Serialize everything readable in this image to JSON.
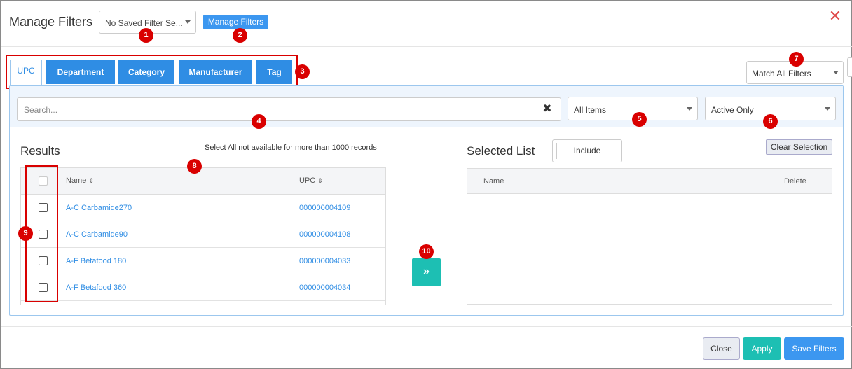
{
  "header": {
    "title": "Manage Filters",
    "saved_filter_select": "No Saved Filter Se...",
    "manage_filters_button": "Manage Filters",
    "close_glyph": "✕"
  },
  "tabs": [
    {
      "label": "UPC",
      "active": true
    },
    {
      "label": "Department",
      "active": false
    },
    {
      "label": "Category",
      "active": false
    },
    {
      "label": "Manufacturer",
      "active": false
    },
    {
      "label": "Tag",
      "active": false
    }
  ],
  "match_select": "Match All Filters",
  "filters": {
    "search_placeholder": "Search...",
    "search_clear_glyph": "✖",
    "items_select": "All Items",
    "status_select": "Active Only"
  },
  "results": {
    "title": "Results",
    "limit_note": "Select All not available for more than 1000 records",
    "columns": {
      "name": "Name",
      "upc": "UPC"
    },
    "rows": [
      {
        "name": "A-C Carbamide270",
        "upc": "000000004109"
      },
      {
        "name": "A-C Carbamide90",
        "upc": "000000004108"
      },
      {
        "name": "A-F Betafood 180",
        "upc": "000000004033"
      },
      {
        "name": "A-F Betafood 360",
        "upc": "000000004034"
      }
    ]
  },
  "selected": {
    "title": "Selected List",
    "include_label": "Include",
    "clear_selection_label": "Clear Selection",
    "columns": {
      "name": "Name",
      "delete": "Delete"
    }
  },
  "move_button_glyph": "»",
  "footer": {
    "close_label": "Close",
    "apply_label": "Apply",
    "save_label": "Save Filters"
  },
  "markers": [
    "1",
    "2",
    "3",
    "4",
    "5",
    "6",
    "7",
    "8",
    "9",
    "10"
  ],
  "colors": {
    "primary": "#3c97f0",
    "tab_blue": "#2f8de4",
    "teal": "#1dbfb3",
    "annotation_red": "#d90000",
    "close_red": "#e04b4b"
  }
}
